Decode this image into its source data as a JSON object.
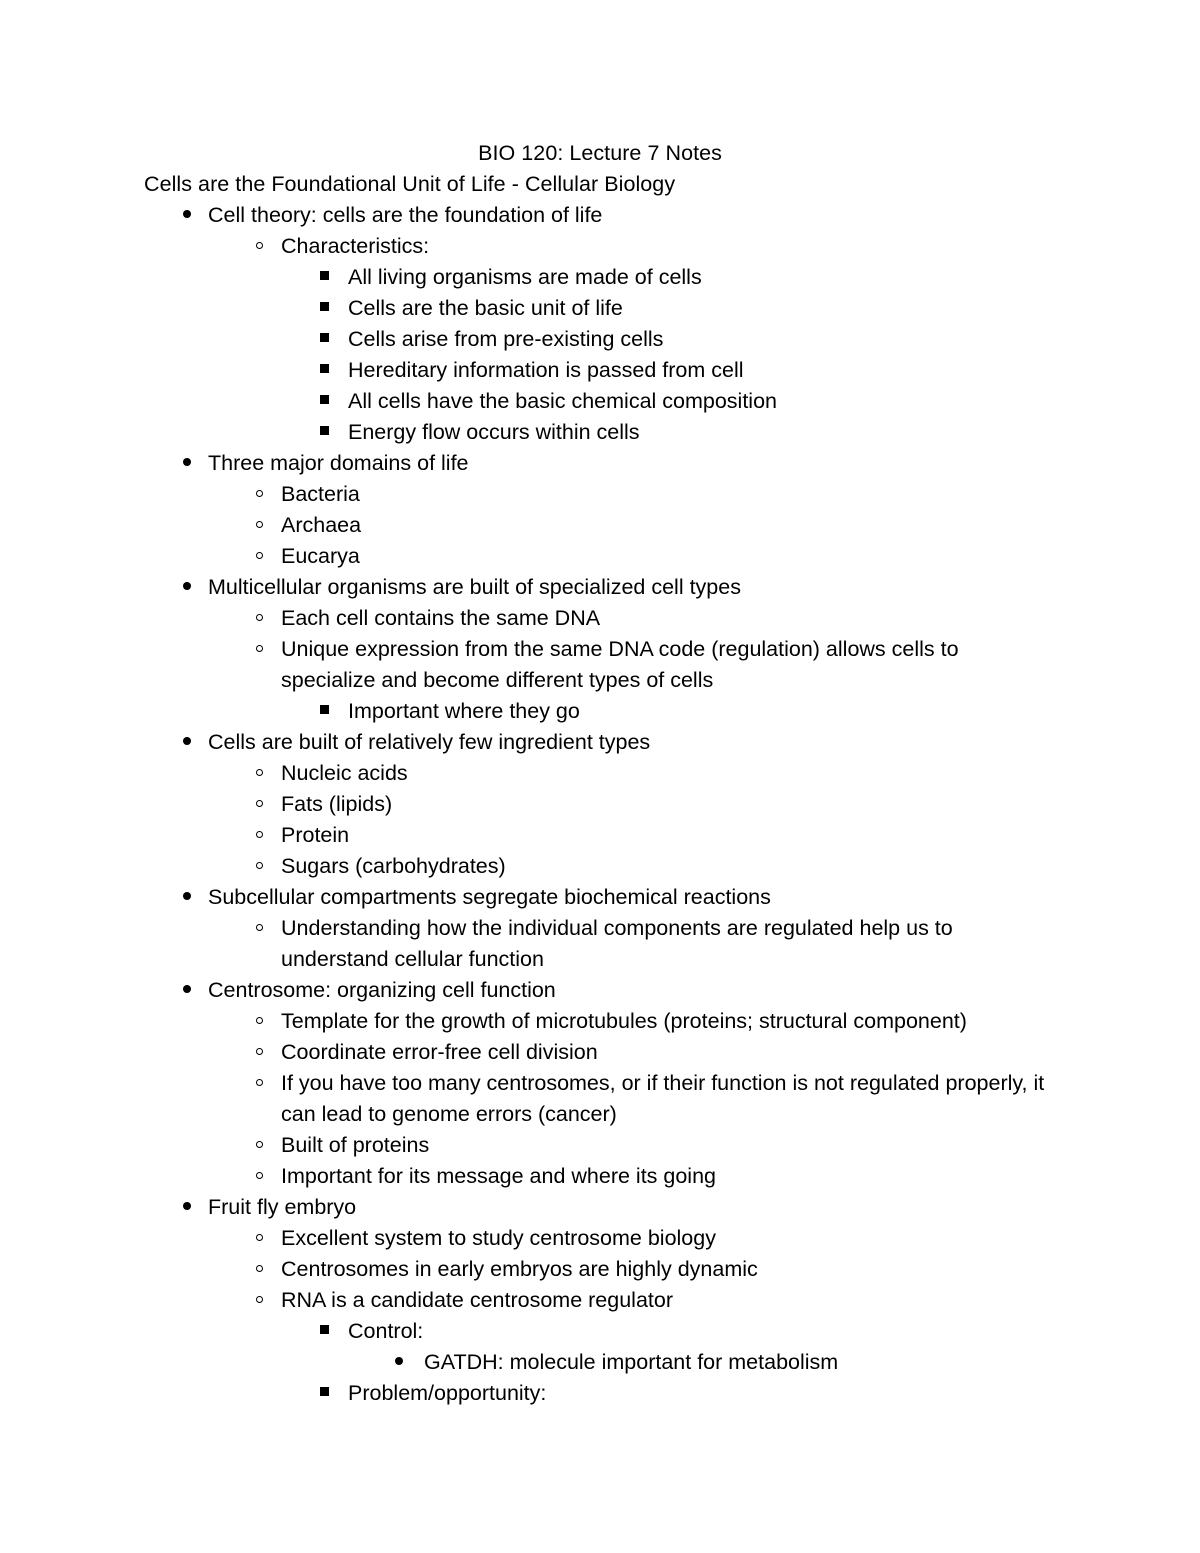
{
  "document": {
    "title": "BIO 120: Lecture 7 Notes",
    "subtitle": "Cells are the Foundational Unit of Life - Cellular Biology",
    "outline": [
      {
        "level": 1,
        "text": "Cell theory: cells are the foundation of life"
      },
      {
        "level": 2,
        "text": "Characteristics:"
      },
      {
        "level": 3,
        "text": "All living organisms are made of cells"
      },
      {
        "level": 3,
        "text": "Cells are the basic unit of life"
      },
      {
        "level": 3,
        "text": "Cells arise from pre-existing cells"
      },
      {
        "level": 3,
        "text": "Hereditary information is passed from cell"
      },
      {
        "level": 3,
        "text": "All cells have the basic chemical composition"
      },
      {
        "level": 3,
        "text": "Energy flow occurs within cells"
      },
      {
        "level": 1,
        "text": "Three major domains of life"
      },
      {
        "level": 2,
        "text": "Bacteria"
      },
      {
        "level": 2,
        "text": "Archaea"
      },
      {
        "level": 2,
        "text": "Eucarya"
      },
      {
        "level": 1,
        "text": "Multicellular organisms are built of specialized cell types"
      },
      {
        "level": 2,
        "text": "Each cell contains the same DNA"
      },
      {
        "level": 2,
        "text": "Unique expression from the same DNA code (regulation) allows cells to specialize and become different types of cells"
      },
      {
        "level": 3,
        "text": "Important where they go"
      },
      {
        "level": 1,
        "text": "Cells are built of relatively few ingredient types"
      },
      {
        "level": 2,
        "text": "Nucleic acids"
      },
      {
        "level": 2,
        "text": "Fats (lipids)"
      },
      {
        "level": 2,
        "text": "Protein"
      },
      {
        "level": 2,
        "text": "Sugars (carbohydrates)"
      },
      {
        "level": 1,
        "text": "Subcellular compartments segregate biochemical reactions"
      },
      {
        "level": 2,
        "text": "Understanding how the individual components are regulated help us to understand cellular function"
      },
      {
        "level": 1,
        "text": "Centrosome: organizing cell function"
      },
      {
        "level": 2,
        "text": "Template for the growth of microtubules (proteins; structural component)"
      },
      {
        "level": 2,
        "text": "Coordinate error-free cell division"
      },
      {
        "level": 2,
        "text": "If you have too many centrosomes, or if their function is not regulated properly, it can lead to genome errors (cancer)"
      },
      {
        "level": 2,
        "text": "Built of proteins"
      },
      {
        "level": 2,
        "text": "Important for its message and where its going"
      },
      {
        "level": 1,
        "text": "Fruit fly embryo"
      },
      {
        "level": 2,
        "text": "Excellent system to study centrosome biology"
      },
      {
        "level": 2,
        "text": "Centrosomes in early embryos are highly dynamic"
      },
      {
        "level": 2,
        "text": "RNA is a candidate centrosome regulator"
      },
      {
        "level": 3,
        "text": "Control:"
      },
      {
        "level": 4,
        "text": "GATDH: molecule important for metabolism"
      },
      {
        "level": 3,
        "text": "Problem/opportunity:"
      }
    ]
  }
}
